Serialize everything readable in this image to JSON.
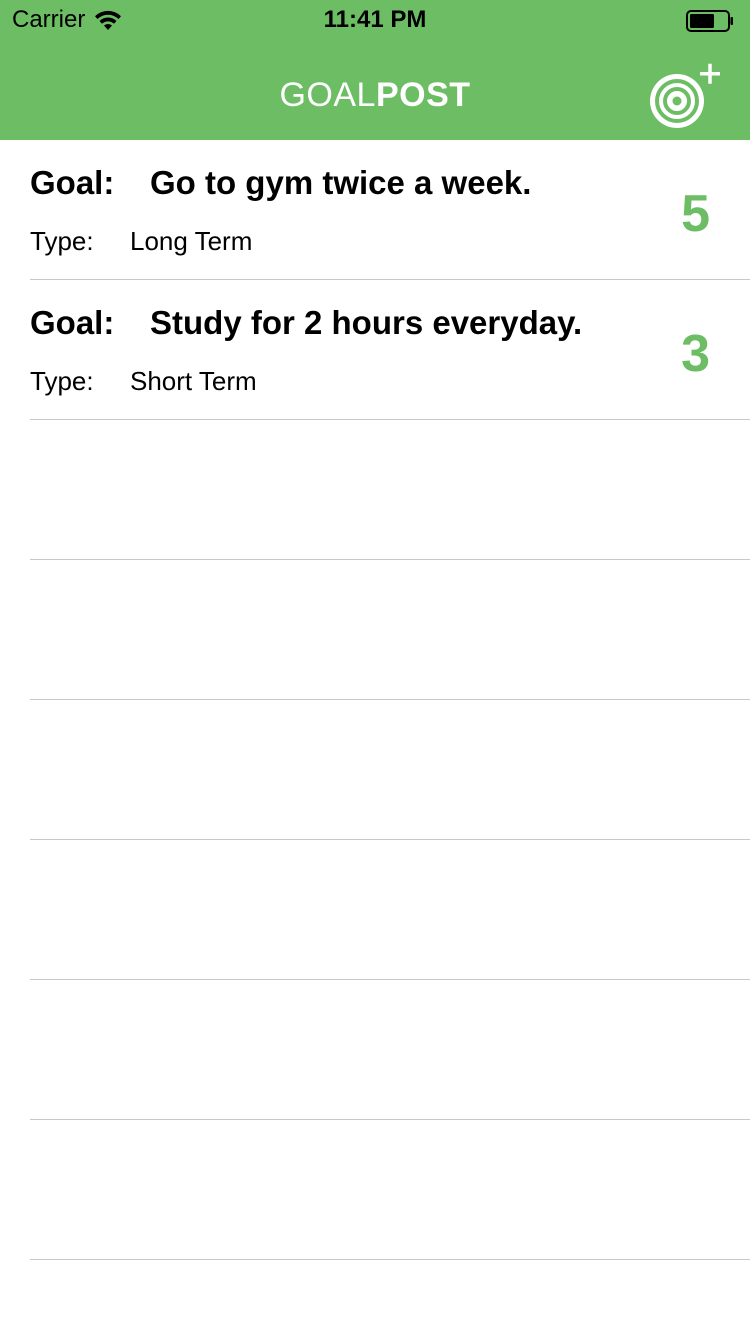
{
  "status_bar": {
    "carrier": "Carrier",
    "time": "11:41 PM"
  },
  "nav": {
    "title_light": "GOAL",
    "title_bold": "POST",
    "add_icon": "target-plus-icon"
  },
  "goals": [
    {
      "goal_label": "Goal:",
      "description": "Go to gym twice a week.",
      "type_label": "Type:",
      "type": "Long Term",
      "progress": "5"
    },
    {
      "goal_label": "Goal:",
      "description": "Study for 2 hours everyday.",
      "type_label": "Type:",
      "type": "Short Term",
      "progress": "3"
    }
  ],
  "colors": {
    "accent": "#6cbd64",
    "separator": "#c8c7cc"
  }
}
